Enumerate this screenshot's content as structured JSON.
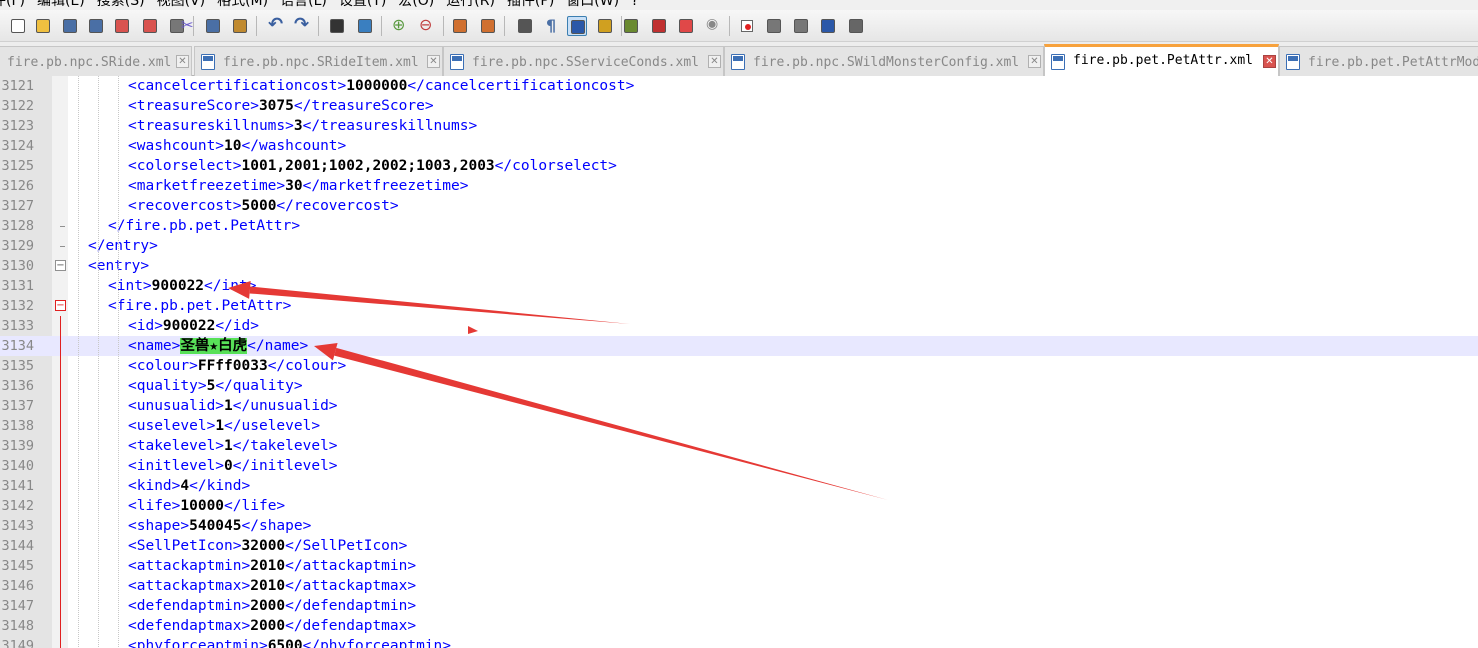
{
  "menubar": {
    "items": [
      "件(F)",
      "编辑(E)",
      "搜索(S)",
      "视图(V)",
      "格式(M)",
      "语言(L)",
      "设置(T)",
      "宏(O)",
      "运行(R)",
      "插件(P)",
      "窗口(W)",
      "?"
    ]
  },
  "toolbar": {
    "buttons": [
      "new-file",
      "open-file",
      "save",
      "save-all",
      "close",
      "close-all",
      "print",
      "cut",
      "copy",
      "paste",
      "undo",
      "redo",
      "find",
      "replace",
      "zoom-in",
      "zoom-out",
      "sync-v",
      "sync-h",
      "word-wrap",
      "show-all-chars",
      "indent-guide",
      "user-lang",
      "doc-map",
      "function-list",
      "folder-workspace",
      "monitor",
      "record-macro",
      "stop-record",
      "play-macro",
      "run-macro-multiple",
      "save-macro"
    ]
  },
  "tabs": [
    {
      "label": "fire.pb.npc.SRide.xml",
      "active": false
    },
    {
      "label": "fire.pb.npc.SRideItem.xml",
      "active": false
    },
    {
      "label": "fire.pb.npc.SServiceConds.xml",
      "active": false
    },
    {
      "label": "fire.pb.npc.SWildMonsterConfig.xml",
      "active": false
    },
    {
      "label": "fire.pb.pet.PetAttr.xml",
      "active": true
    },
    {
      "label": "fire.pb.pet.PetAttrMod",
      "active": false
    }
  ],
  "editor": {
    "current_line": "3134",
    "lines": [
      {
        "num": "3121",
        "indent": 3,
        "open": "<cancelcertificationcost>",
        "value": "1000000",
        "close": "</cancelcertificationcost>"
      },
      {
        "num": "3122",
        "indent": 3,
        "open": "<treasureScore>",
        "value": "3075",
        "close": "</treasureScore>"
      },
      {
        "num": "3123",
        "indent": 3,
        "open": "<treasureskillnums>",
        "value": "3",
        "close": "</treasureskillnums>"
      },
      {
        "num": "3124",
        "indent": 3,
        "open": "<washcount>",
        "value": "10",
        "close": "</washcount>"
      },
      {
        "num": "3125",
        "indent": 3,
        "open": "<colorselect>",
        "value": "1001,2001;1002,2002;1003,2003",
        "close": "</colorselect>"
      },
      {
        "num": "3126",
        "indent": 3,
        "open": "<marketfreezetime>",
        "value": "30",
        "close": "</marketfreezetime>"
      },
      {
        "num": "3127",
        "indent": 3,
        "open": "<recovercost>",
        "value": "5000",
        "close": "</recovercost>"
      },
      {
        "num": "3128",
        "indent": 2,
        "open": "</fire.pb.pet.PetAttr>",
        "value": "",
        "close": ""
      },
      {
        "num": "3129",
        "indent": 1,
        "open": "</entry>",
        "value": "",
        "close": ""
      },
      {
        "num": "3130",
        "indent": 1,
        "open": "<entry>",
        "value": "",
        "close": ""
      },
      {
        "num": "3131",
        "indent": 2,
        "open": "<int>",
        "value": "900022",
        "close": "</int>"
      },
      {
        "num": "3132",
        "indent": 2,
        "open": "<fire.pb.pet.PetAttr>",
        "value": "",
        "close": ""
      },
      {
        "num": "3133",
        "indent": 3,
        "open": "<id>",
        "value": "900022",
        "close": "</id>"
      },
      {
        "num": "3134",
        "indent": 3,
        "open": "<name>",
        "value": "圣兽★白虎",
        "close": "</name>",
        "selected": true
      },
      {
        "num": "3135",
        "indent": 3,
        "open": "<colour>",
        "value": "FFff0033",
        "close": "</colour>"
      },
      {
        "num": "3136",
        "indent": 3,
        "open": "<quality>",
        "value": "5",
        "close": "</quality>"
      },
      {
        "num": "3137",
        "indent": 3,
        "open": "<unusualid>",
        "value": "1",
        "close": "</unusualid>"
      },
      {
        "num": "3138",
        "indent": 3,
        "open": "<uselevel>",
        "value": "1",
        "close": "</uselevel>"
      },
      {
        "num": "3139",
        "indent": 3,
        "open": "<takelevel>",
        "value": "1",
        "close": "</takelevel>"
      },
      {
        "num": "3140",
        "indent": 3,
        "open": "<initlevel>",
        "value": "0",
        "close": "</initlevel>"
      },
      {
        "num": "3141",
        "indent": 3,
        "open": "<kind>",
        "value": "4",
        "close": "</kind>"
      },
      {
        "num": "3142",
        "indent": 3,
        "open": "<life>",
        "value": "10000",
        "close": "</life>"
      },
      {
        "num": "3143",
        "indent": 3,
        "open": "<shape>",
        "value": "540045",
        "close": "</shape>"
      },
      {
        "num": "3144",
        "indent": 3,
        "open": "<SellPetIcon>",
        "value": "32000",
        "close": "</SellPetIcon>"
      },
      {
        "num": "3145",
        "indent": 3,
        "open": "<attackaptmin>",
        "value": "2010",
        "close": "</attackaptmin>"
      },
      {
        "num": "3146",
        "indent": 3,
        "open": "<attackaptmax>",
        "value": "2010",
        "close": "</attackaptmax>"
      },
      {
        "num": "3147",
        "indent": 3,
        "open": "<defendaptmin>",
        "value": "2000",
        "close": "</defendaptmin>"
      },
      {
        "num": "3148",
        "indent": 3,
        "open": "<defendaptmax>",
        "value": "2000",
        "close": "</defendaptmax>"
      },
      {
        "num": "3149",
        "indent": 3,
        "open": "<phyforceaptmin>",
        "value": "6500",
        "close": "</phyforceaptmin>"
      }
    ]
  },
  "colors": {
    "tag": "#0000ff",
    "value": "#000000",
    "selection": "#58e058",
    "current_line": "#e8e8ff",
    "annotation_arrow": "#e53935",
    "active_tab_accent": "#f7a23d"
  }
}
